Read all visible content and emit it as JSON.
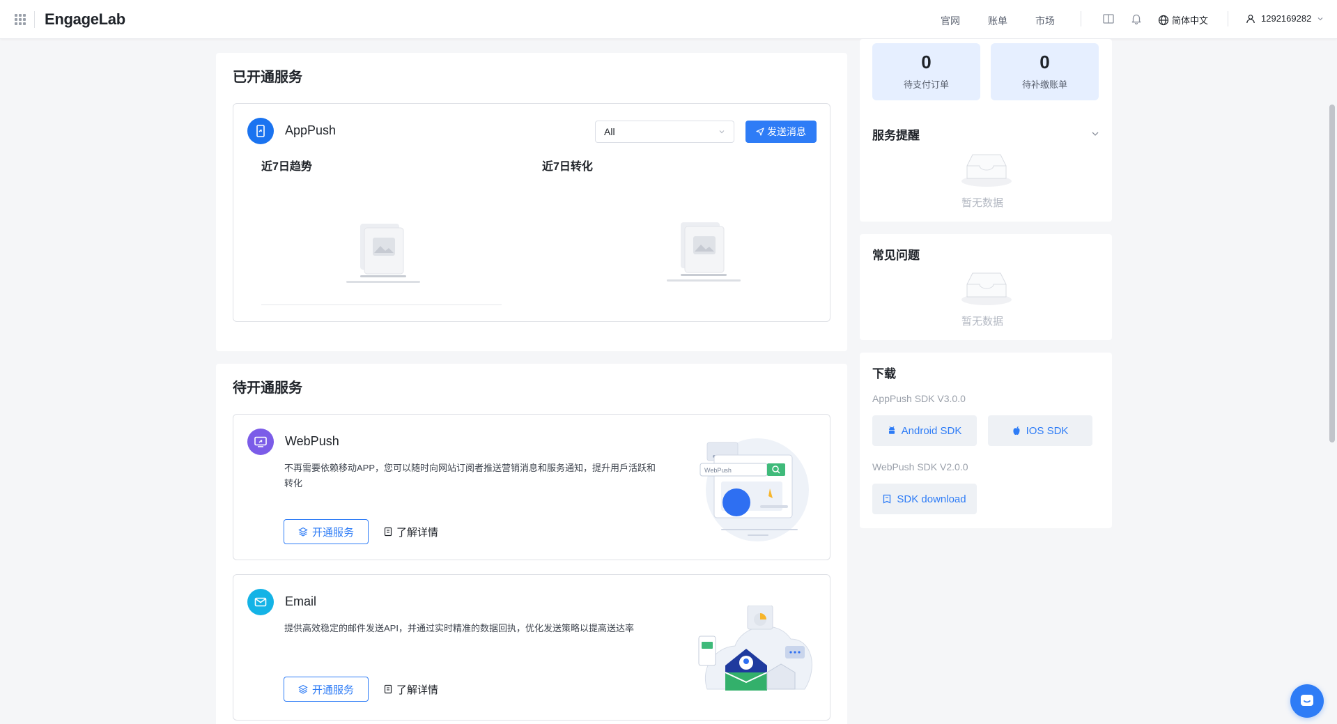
{
  "header": {
    "logo": "EngageLab",
    "nav": [
      "官网",
      "账单",
      "市场"
    ],
    "language": "简体中文",
    "user_id": "1292169282"
  },
  "opened_services": {
    "title": "已开通服务",
    "apppush": {
      "name": "AppPush",
      "filter_value": "All",
      "send_button": "发送消息",
      "trend_title": "近7日趋势",
      "conversion_title": "近7日转化"
    }
  },
  "pending_services": {
    "title": "待开通服务",
    "webpush": {
      "name": "WebPush",
      "description": "不再需要依赖移动APP，您可以随时向网站订阅者推送营销消息和服务通知，提升用戶活跃和转化",
      "open_button": "开通服务",
      "details_link": "了解详情",
      "illustration_search_text": "WebPush"
    },
    "email": {
      "name": "Email",
      "description": "提供高效稳定的邮件发送API，并通过实时精准的数据回执，优化发送策略以提高送达率",
      "open_button": "开通服务",
      "details_link": "了解详情"
    }
  },
  "stats": {
    "pending_orders": {
      "value": "0",
      "label": "待支付订单"
    },
    "pending_bills": {
      "value": "0",
      "label": "待补缴账单"
    }
  },
  "reminders": {
    "title": "服务提醒",
    "empty_text": "暂无数据"
  },
  "faq": {
    "title": "常见问题",
    "empty_text": "暂无数据"
  },
  "downloads": {
    "title": "下载",
    "apppush_sdk_label": "AppPush SDK V3.0.0",
    "android_button": "Android SDK",
    "ios_button": "IOS SDK",
    "webpush_sdk_label": "WebPush SDK V2.0.0",
    "sdk_download_button": "SDK download"
  },
  "colors": {
    "primary": "#2e7cf6",
    "apppush_icon": "#1a73f0",
    "webpush_icon": "#7b5ce8",
    "email_icon": "#14b3e6",
    "stat_bg": "#e6efff"
  }
}
